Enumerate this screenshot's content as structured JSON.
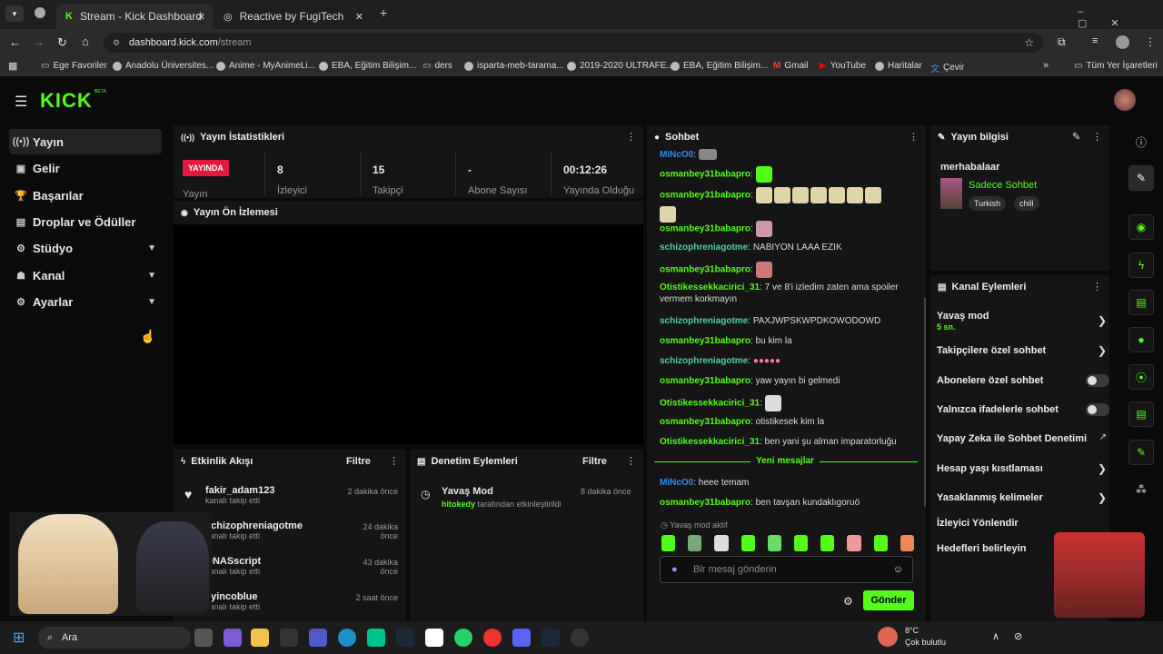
{
  "browser": {
    "tabs": [
      {
        "label": "Stream - Kick Dashboard"
      },
      {
        "label": "Reactive by FugiTech"
      }
    ],
    "url_host": "dashboard.kick.com",
    "url_path": "/stream",
    "bookmarks": [
      "Ege Favoriler",
      "Anadolu Üniversites...",
      "Anime - MyAnimeLi...",
      "EBA, Eğitim Bilişim...",
      "ders",
      "isparta-meb-tarama...",
      "2019-2020 ULTRAFE...",
      "EBA, Eğitim Bilişim...",
      "Gmail",
      "YouTube",
      "Haritalar",
      "Çevir"
    ],
    "all_bookmarks": "Tüm Yer İşaretleri"
  },
  "kick": {
    "logo": "KICK",
    "beta": "BETA"
  },
  "sidebar": {
    "items": [
      {
        "label": "Yayın",
        "icon": "broadcast-icon"
      },
      {
        "label": "Gelir",
        "icon": "revenue-icon"
      },
      {
        "label": "Başarılar",
        "icon": "trophy-icon"
      },
      {
        "label": "Droplar ve Ödüller",
        "icon": "drops-icon"
      },
      {
        "label": "Stüdyo",
        "icon": "studio-icon"
      },
      {
        "label": "Kanal",
        "icon": "channel-icon"
      },
      {
        "label": "Ayarlar",
        "icon": "settings-icon"
      }
    ]
  },
  "stats": {
    "title": "Yayın İstatistikleri",
    "live_badge": "YAYINDA",
    "live_label": "Yayın",
    "viewers": "8",
    "viewers_label": "İzleyici",
    "followers": "15",
    "followers_label": "Takipçi",
    "subs": "-",
    "subs_label": "Abone Sayısı",
    "uptime": "00:12:26",
    "uptime_label": "Yayında Olduğu"
  },
  "preview": {
    "title": "Yayın Ön İzlemesi"
  },
  "activity": {
    "title": "Etkinlik Akışı",
    "filter": "Filtre",
    "events": [
      {
        "name": "fakir_adam123",
        "sub": "kanalı takip etti",
        "time": "2 dakika önce"
      },
      {
        "name": "schizophreniagotme",
        "sub": "kanalı takip etti",
        "time": "24 dakika önce"
      },
      {
        "name": "DNASscript",
        "sub": "kanalı takip etti",
        "time": "43 dakika önce"
      },
      {
        "name": "ayincoblue",
        "sub": "kanalı takip etti",
        "time": "2 saat önce"
      }
    ]
  },
  "moderation": {
    "title": "Denetim Eylemleri",
    "filter": "Filtre",
    "item_title": "Yavaş Mod",
    "item_user": "hitokedy",
    "item_text": "tarafından etkinleştirildi",
    "item_time": "8 dakika önce"
  },
  "chat": {
    "title": "Sohbet",
    "messages": [
      {
        "user": "MiNcO0",
        "text": ""
      },
      {
        "user": "osmanbey31babapro",
        "text": ""
      },
      {
        "user": "osmanbey31babapro",
        "text": ""
      },
      {
        "user": "osmanbey31babapro",
        "text": ""
      },
      {
        "user": "schizophreniagotme",
        "text": "NABIYON LAAA EZIK"
      },
      {
        "user": "osmanbey31babapro",
        "text": ""
      },
      {
        "user": "Otistikessekkacirici_31",
        "text": "7 ve 8'i izledim zaten ama spoiler vermem korkmayın"
      },
      {
        "user": "schizophreniagotme",
        "text": "PAXJWPSKWPDKOWODOWD"
      },
      {
        "user": "osmanbey31babapro",
        "text": "bu kim la"
      },
      {
        "user": "schizophreniagotme",
        "text": ""
      },
      {
        "user": "osmanbey31babapro",
        "text": "yaw yayın bi gelmedi"
      },
      {
        "user": "Otistikessekkacirici_31",
        "text": ""
      },
      {
        "user": "osmanbey31babapro",
        "text": "otistikesek kim la"
      },
      {
        "user": "Otistikessekkacirici_31",
        "text": "ben yani şu alman imparatorluğu"
      },
      {
        "user": "MiNcO0",
        "text": "heee temam"
      },
      {
        "user": "osmanbey31babapro",
        "text": "ben tavşan kundaklıgoruö"
      }
    ],
    "new_messages": "Yeni mesajlar",
    "slow_mode": "Yavaş mod aktif",
    "input_placeholder": "Bir mesaj gönderin",
    "send": "Gönder"
  },
  "stream_info": {
    "title": "Yayın bilgisi",
    "stream_title": "merhabalaar",
    "category": "Sadece Sohbet",
    "tags": [
      "Turkish",
      "chill"
    ]
  },
  "channel_actions": {
    "title": "Kanal Eylemleri",
    "slow_mode": "Yavaş mod",
    "slow_mode_value": "5 sn.",
    "items": [
      "Takipçilere özel sohbet",
      "Abonelere özel sohbet",
      "Yalnızca ifadelerle sohbet",
      "Yapay Zeka ile Sohbet Denetimi",
      "Hesap yaşı kısıtlaması",
      "Yasaklanmış kelimeler",
      "İzleyici Yönlendir",
      "Hedefleri belirleyin"
    ]
  },
  "taskbar": {
    "search": "Ara",
    "temp": "8°C",
    "weather": "Çok bulutlu"
  },
  "colors": {
    "accent": "#53fc18",
    "live": "#e5193d"
  }
}
